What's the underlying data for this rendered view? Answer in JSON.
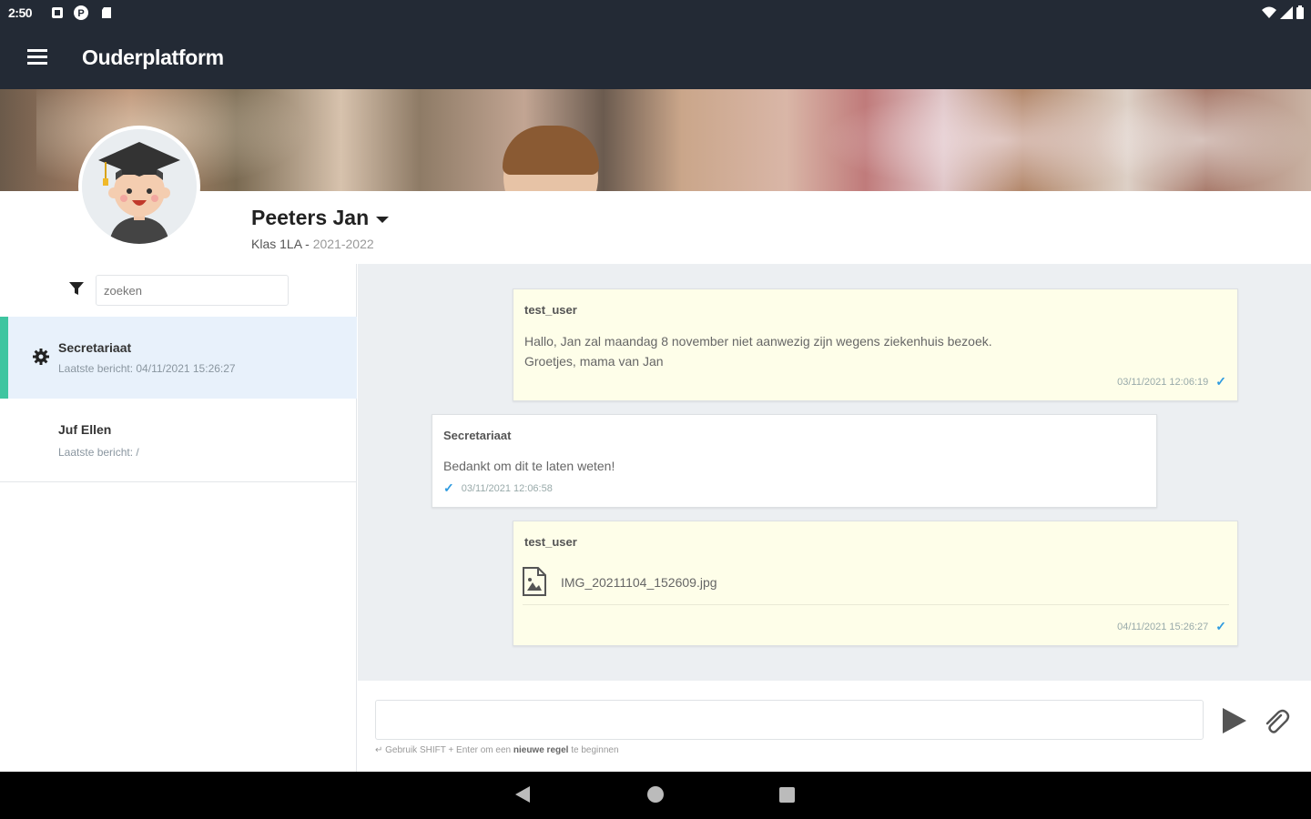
{
  "status_bar": {
    "time": "2:50",
    "icons": [
      "notification-icon",
      "p-icon",
      "sd-card-icon",
      "wifi-icon",
      "signal-icon",
      "battery-icon"
    ]
  },
  "app_bar": {
    "title": "Ouderplatform",
    "menu_icon": "hamburger-icon"
  },
  "profile": {
    "name": "Peeters Jan",
    "class_label": "Klas 1LA",
    "separator": " - ",
    "year": "2021-2022"
  },
  "sidebar": {
    "search_placeholder": "zoeken",
    "conversations": [
      {
        "title": "Secretariaat",
        "subtitle": "Laatste bericht: 04/11/2021 15:26:27",
        "icon": "gear-icon",
        "active": true
      },
      {
        "title": "Juf Ellen",
        "subtitle": "Laatste bericht: /",
        "active": false
      }
    ]
  },
  "messages": [
    {
      "author": "test_user",
      "lines": [
        "Hallo, Jan zal maandag 8 november niet aanwezig zijn wegens ziekenhuis bezoek.",
        "Groetjes, mama van Jan"
      ],
      "timestamp": "03/11/2021 12:06:19",
      "read": true,
      "mine": true
    },
    {
      "author": "Secretariaat",
      "lines": [
        "Bedankt om dit te laten weten!"
      ],
      "timestamp": "03/11/2021 12:06:58",
      "read": true,
      "mine": false
    },
    {
      "author": "test_user",
      "attachment": "IMG_20211104_152609.jpg",
      "timestamp": "04/11/2021 15:26:27",
      "read": true,
      "mine": true
    }
  ],
  "composer": {
    "hint_prefix": "↵ Gebruik SHIFT + Enter om een ",
    "hint_bold": "nieuwe regel",
    "hint_suffix": " te beginnen",
    "send_icon": "send-icon",
    "attach_icon": "paperclip-icon"
  },
  "colors": {
    "app_bar": "#232a35",
    "active_accent": "#3fc5a0",
    "active_bg": "#e8f1fb",
    "own_message_bg": "#fefee9",
    "chat_bg": "#eceff2",
    "read_tick": "#2f9be0"
  }
}
